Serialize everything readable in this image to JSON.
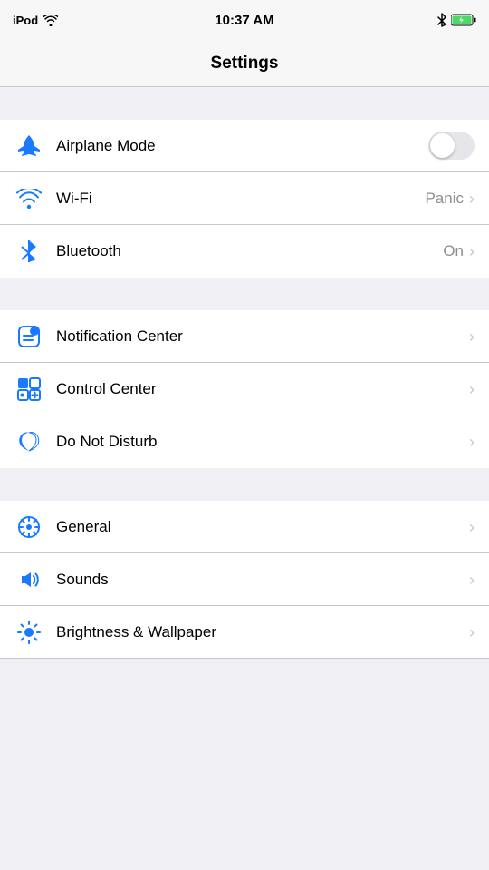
{
  "statusBar": {
    "carrier": "iPod",
    "time": "10:37 AM",
    "wifi": true,
    "bluetooth": true,
    "battery": "full"
  },
  "navBar": {
    "title": "Settings"
  },
  "sections": [
    {
      "id": "connectivity",
      "rows": [
        {
          "id": "airplane-mode",
          "label": "Airplane Mode",
          "icon": "airplane",
          "control": "toggle",
          "toggleState": "off",
          "value": ""
        },
        {
          "id": "wifi",
          "label": "Wi-Fi",
          "icon": "wifi",
          "control": "chevron",
          "value": "Panic"
        },
        {
          "id": "bluetooth",
          "label": "Bluetooth",
          "icon": "bluetooth",
          "control": "chevron",
          "value": "On"
        }
      ]
    },
    {
      "id": "system",
      "rows": [
        {
          "id": "notification-center",
          "label": "Notification Center",
          "icon": "notification",
          "control": "chevron",
          "value": ""
        },
        {
          "id": "control-center",
          "label": "Control Center",
          "icon": "control",
          "control": "chevron",
          "value": ""
        },
        {
          "id": "do-not-disturb",
          "label": "Do Not Disturb",
          "icon": "dnd",
          "control": "chevron",
          "value": ""
        }
      ]
    },
    {
      "id": "device",
      "rows": [
        {
          "id": "general",
          "label": "General",
          "icon": "general",
          "control": "chevron",
          "value": ""
        },
        {
          "id": "sounds",
          "label": "Sounds",
          "icon": "sounds",
          "control": "chevron",
          "value": ""
        },
        {
          "id": "brightness-wallpaper",
          "label": "Brightness & Wallpaper",
          "icon": "brightness",
          "control": "chevron",
          "value": ""
        }
      ]
    }
  ]
}
